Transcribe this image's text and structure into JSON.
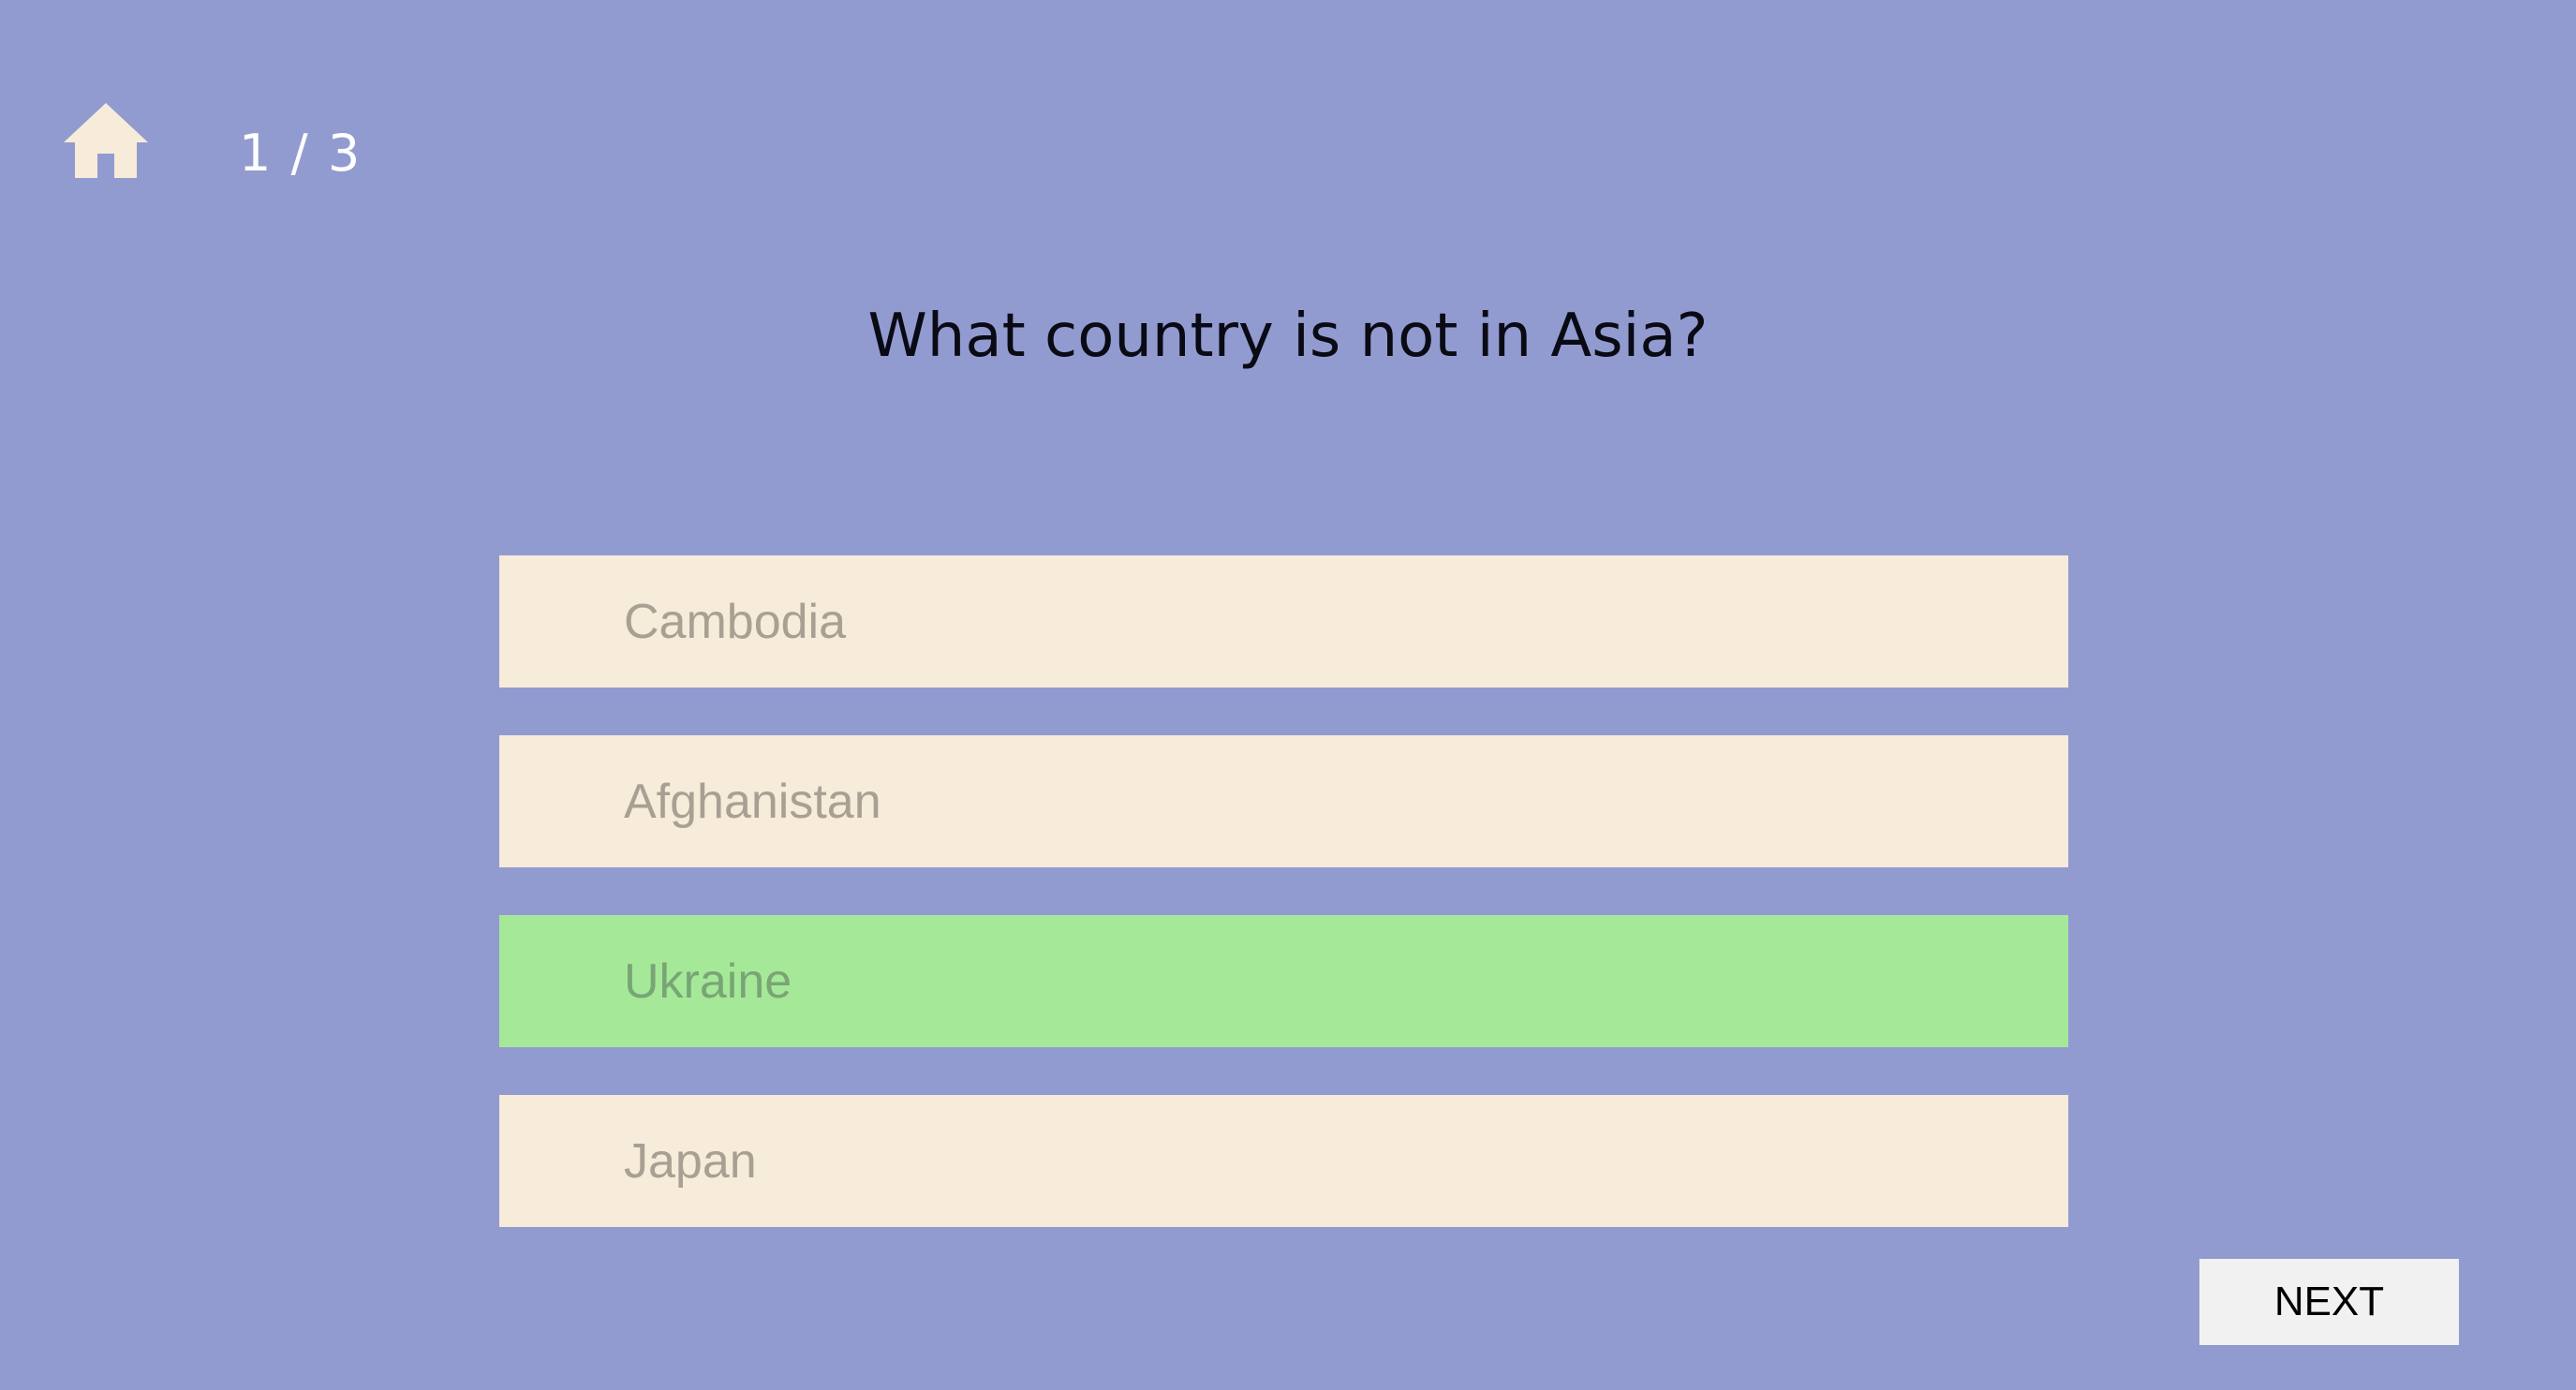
{
  "header": {
    "home_icon": "home-icon",
    "progress": "1 / 3"
  },
  "question": {
    "text": "What country is not in Asia?"
  },
  "options": [
    {
      "label": "Cambodia",
      "state": "default"
    },
    {
      "label": "Afghanistan",
      "state": "default"
    },
    {
      "label": "Ukraine",
      "state": "correct"
    },
    {
      "label": "Japan",
      "state": "default"
    }
  ],
  "footer": {
    "next_label": "NEXT"
  },
  "colors": {
    "background": "#929bd0",
    "option_bg": "#f7ebda",
    "correct_bg": "#a5e998",
    "home_icon": "#f7ebda",
    "next_bg": "#f1f1f1"
  }
}
